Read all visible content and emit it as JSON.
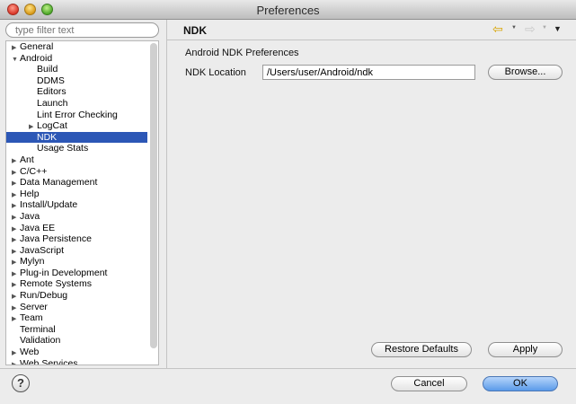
{
  "window": {
    "title": "Preferences"
  },
  "filter": {
    "placeholder": "type filter text"
  },
  "tree": [
    {
      "label": "General",
      "level": 0,
      "arrow": "right"
    },
    {
      "label": "Android",
      "level": 0,
      "arrow": "down"
    },
    {
      "label": "Build",
      "level": 1,
      "arrow": ""
    },
    {
      "label": "DDMS",
      "level": 1,
      "arrow": ""
    },
    {
      "label": "Editors",
      "level": 1,
      "arrow": ""
    },
    {
      "label": "Launch",
      "level": 1,
      "arrow": ""
    },
    {
      "label": "Lint Error Checking",
      "level": 1,
      "arrow": ""
    },
    {
      "label": "LogCat",
      "level": 1,
      "arrow": "right"
    },
    {
      "label": "NDK",
      "level": 1,
      "arrow": "",
      "selected": true
    },
    {
      "label": "Usage Stats",
      "level": 1,
      "arrow": ""
    },
    {
      "label": "Ant",
      "level": 0,
      "arrow": "right"
    },
    {
      "label": "C/C++",
      "level": 0,
      "arrow": "right"
    },
    {
      "label": "Data Management",
      "level": 0,
      "arrow": "right"
    },
    {
      "label": "Help",
      "level": 0,
      "arrow": "right"
    },
    {
      "label": "Install/Update",
      "level": 0,
      "arrow": "right"
    },
    {
      "label": "Java",
      "level": 0,
      "arrow": "right"
    },
    {
      "label": "Java EE",
      "level": 0,
      "arrow": "right"
    },
    {
      "label": "Java Persistence",
      "level": 0,
      "arrow": "right"
    },
    {
      "label": "JavaScript",
      "level": 0,
      "arrow": "right"
    },
    {
      "label": "Mylyn",
      "level": 0,
      "arrow": "right"
    },
    {
      "label": "Plug-in Development",
      "level": 0,
      "arrow": "right"
    },
    {
      "label": "Remote Systems",
      "level": 0,
      "arrow": "right"
    },
    {
      "label": "Run/Debug",
      "level": 0,
      "arrow": "right"
    },
    {
      "label": "Server",
      "level": 0,
      "arrow": "right"
    },
    {
      "label": "Team",
      "level": 0,
      "arrow": "right"
    },
    {
      "label": "Terminal",
      "level": 0,
      "arrow": ""
    },
    {
      "label": "Validation",
      "level": 0,
      "arrow": ""
    },
    {
      "label": "Web",
      "level": 0,
      "arrow": "right"
    },
    {
      "label": "Web Services",
      "level": 0,
      "arrow": "right"
    }
  ],
  "page": {
    "heading": "NDK",
    "section_title": "Android NDK Preferences",
    "ndk_location_label": "NDK Location",
    "ndk_location_value": "/Users/user/Android/ndk",
    "browse_label": "Browse..."
  },
  "nav": {
    "back_icon": "back-arrow-icon",
    "forward_icon": "forward-arrow-icon",
    "menu_icon": "view-menu-icon",
    "back_color": "#d8a400"
  },
  "buttons": {
    "restore_defaults": "Restore Defaults",
    "apply": "Apply",
    "cancel": "Cancel",
    "ok": "OK"
  },
  "help": {
    "glyph": "?"
  },
  "colors": {
    "selection": "#2c57b6",
    "default_button": "#5a9ae9"
  }
}
